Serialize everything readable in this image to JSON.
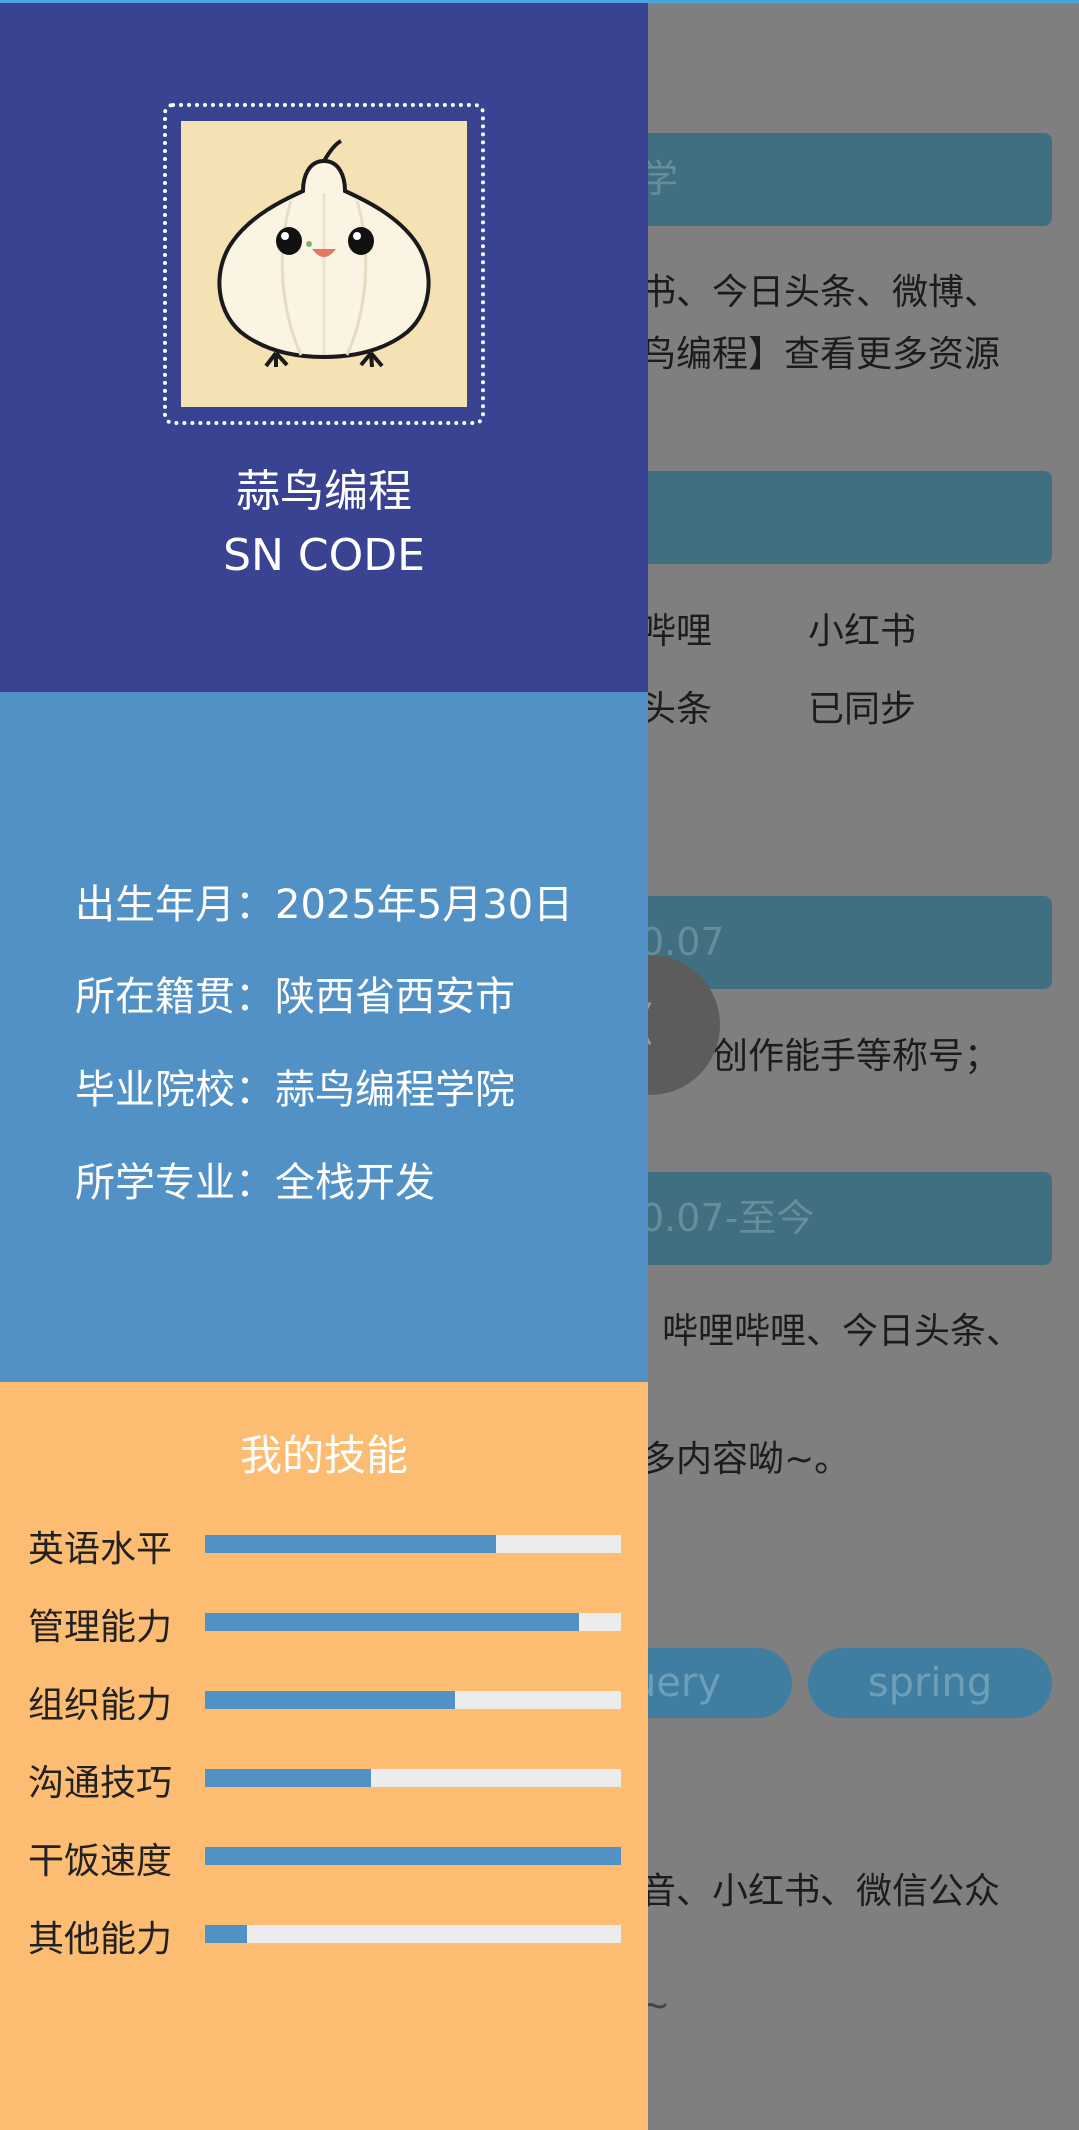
{
  "background": {
    "bars": [
      "学",
      "",
      "0.07",
      "0.07-至今"
    ],
    "texts": {
      "line1": "书、今日头条、微博、",
      "line2": "鸟编程】查看更多资源",
      "grid1a": "哔哩",
      "grid1b": "小红书",
      "grid2a": "头条",
      "grid2b": "已同步",
      "honor": "误、创作能手等称号；",
      "platforms": "哔哩哔哩、今日头条、",
      "more": "多内容呦~。",
      "last": "音、小红书、微信公众",
      "tilde": "~"
    },
    "pills": [
      "uery",
      "spring"
    ],
    "float_button": "《"
  },
  "profile": {
    "name": "蒜鸟编程",
    "subtitle": "SN CODE",
    "avatar_icon": "garlic-mascot-icon"
  },
  "info": [
    {
      "label": "出生年月：",
      "value": "2025年5月30日"
    },
    {
      "label": "所在籍贯：",
      "value": "陕西省西安市"
    },
    {
      "label": "毕业院校：",
      "value": "蒜鸟编程学院"
    },
    {
      "label": "所学专业：",
      "value": "全栈开发"
    }
  ],
  "skills": {
    "title": "我的技能",
    "items": [
      {
        "name": "英语水平",
        "level": 0.7
      },
      {
        "name": "管理能力",
        "level": 0.9
      },
      {
        "name": "组织能力",
        "level": 0.6
      },
      {
        "name": "沟通技巧",
        "level": 0.4
      },
      {
        "name": "干饭速度",
        "level": 1.0
      },
      {
        "name": "其他能力",
        "level": 0.1
      }
    ]
  },
  "colors": {
    "profile_bg": "#3a4292",
    "info_bg": "#5291c6",
    "skills_bg": "#fcbd72",
    "skill_fill": "#5291c6",
    "skill_track": "#ececec"
  }
}
